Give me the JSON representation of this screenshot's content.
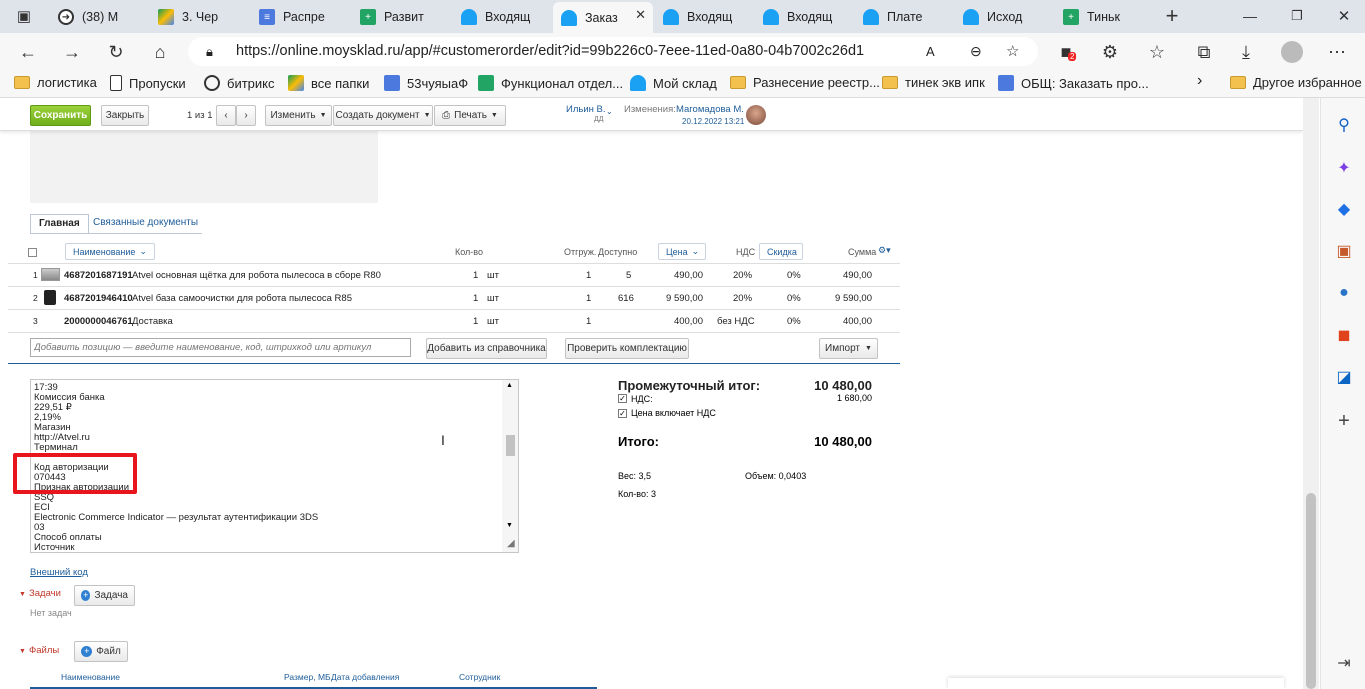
{
  "browser": {
    "tabs": [
      {
        "label": "(38) M",
        "color": "#333"
      },
      {
        "label": "3. Чер",
        "color": "#3a7ae8"
      },
      {
        "label": "Распре",
        "color": "#4b79de"
      },
      {
        "label": "Развит",
        "color": "#21a464"
      },
      {
        "label": "Входящ",
        "color": "#1aa1f3"
      },
      {
        "label": "Заказ",
        "color": "#1aa1f3"
      },
      {
        "label": "Входящ",
        "color": "#1aa1f3"
      },
      {
        "label": "Входящ",
        "color": "#1aa1f3"
      },
      {
        "label": "Плате",
        "color": "#1aa1f3"
      },
      {
        "label": "Исход",
        "color": "#1aa1f3"
      },
      {
        "label": "Тиньк",
        "color": "#21a464"
      }
    ],
    "url": "https://online.moysklad.ru/app/#customerorder/edit?id=99b226c0-7eee-11ed-0a80-04b7002c26d1",
    "badge_count": "2",
    "favorites": [
      "логистика",
      "Пропуски",
      "битрикс",
      "все папки",
      "53чуяыаФ",
      "Функционал отдел...",
      "Мой склад",
      "Разнесение реестр...",
      "тинек экв ипк",
      "ОБЩ: Заказать про...",
      "Другое избранное"
    ]
  },
  "toolbar": {
    "save": "Сохранить",
    "close": "Закрыть",
    "pager": "1 из 1",
    "edit": "Изменить",
    "create_doc": "Создать документ",
    "print": "Печать",
    "user": "Ильин В.",
    "user_sub": "ДД",
    "changes_label": "Изменения:",
    "changes_user": "Магомадова М.",
    "changes_date": "20.12.2022 13:21"
  },
  "doc_tabs": {
    "main": "Главная",
    "related": "Связанные документы"
  },
  "table": {
    "headers": {
      "name": "Наименование",
      "qty": "Кол-во",
      "shipped": "Отгруж.",
      "available": "Доступно",
      "price": "Цена",
      "vat": "НДС",
      "discount": "Скидка",
      "sum": "Сумма"
    },
    "rows": [
      {
        "n": "1",
        "code": "4687201687191",
        "name": "Atvel основная щётка для робота пылесоса в сборе R80",
        "qty": "1",
        "unit": "шт",
        "shipped": "1",
        "available": "5",
        "price": "490,00",
        "vat": "20%",
        "discount": "0%",
        "sum": "490,00"
      },
      {
        "n": "2",
        "code": "4687201946410",
        "name": "Atvel база самоочистки для робота пылесоса R85",
        "qty": "1",
        "unit": "шт",
        "shipped": "1",
        "available": "616",
        "price": "9 590,00",
        "vat": "20%",
        "discount": "0%",
        "sum": "9 590,00"
      },
      {
        "n": "3",
        "code": "2000000046761",
        "name": "Доставка",
        "qty": "1",
        "unit": "шт",
        "shipped": "1",
        "available": "",
        "price": "400,00",
        "vat": "без НДС",
        "discount": "0%",
        "sum": "400,00"
      }
    ],
    "add_placeholder": "Добавить позицию — введите наименование, код, штрихкод или артикул",
    "add_from_catalog": "Добавить из справочника",
    "check_kit": "Проверить комплектацию",
    "import": "Импорт"
  },
  "memo": {
    "lines": [
      "17:39",
      "Комиссия банка",
      "229,51 ₽",
      "2,19%",
      "Магазин",
      "http://Atvel.ru",
      "Терминал",
      "",
      "Код авторизации",
      "070443",
      "Признак авторизации",
      "SSQ",
      "ECI",
      "Electronic Commerce Indicator — результат аутентификации 3DS",
      "03",
      "Способ оплаты",
      "Источник"
    ]
  },
  "summary": {
    "subtotal_label": "Промежуточный итог:",
    "subtotal": "10 480,00",
    "vat_label": "НДС:",
    "vat": "1 680,00",
    "price_incl_vat": "Цена включает НДС",
    "total_label": "Итого:",
    "total": "10 480,00",
    "weight": "Вес: 3,5",
    "volume": "Объем: 0,0403",
    "count": "Кол-во: 3"
  },
  "external_code": "Внешний код",
  "tasks": {
    "label": "Задачи",
    "button": "Задача",
    "empty": "Нет задач"
  },
  "files": {
    "label": "Файлы",
    "button": "Файл",
    "col_name": "Наименование",
    "col_size": "Размер, МБ",
    "col_date": "Дата добавления",
    "col_user": "Сотрудник"
  },
  "colors": {
    "highlight": "#e8161c",
    "save_green": "#7fbf26",
    "link": "#1f5d99"
  }
}
